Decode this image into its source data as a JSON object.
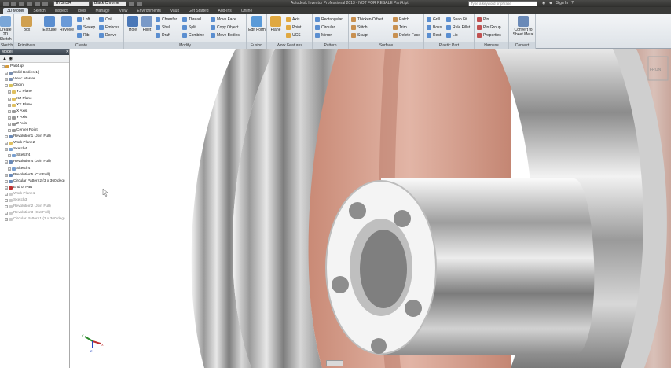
{
  "titlebar": {
    "combo1": "BVS.ISR",
    "combo2": "Black Chrome",
    "title": "Autodesk Inventor Professional 2013 - NOT FOR RESALE   Part4.ipt",
    "search_placeholder": "Type a keyword or phrase",
    "user": "Sign In"
  },
  "tabs": [
    "3D Model",
    "Sketch",
    "Inspect",
    "Tools",
    "Manage",
    "View",
    "Environments",
    "Vault",
    "Get Started",
    "Add-Ins",
    "Online"
  ],
  "ribbon": {
    "sketch": {
      "label": "Create 2D Sketch",
      "panel": "Sketch"
    },
    "primitives": {
      "box": "Box",
      "panel": "Primitives"
    },
    "create": {
      "extrude": "Extrude",
      "revolve": "Revolve",
      "loft": "Loft",
      "sweep": "Sweep",
      "rib": "Rib",
      "coil": "Coil",
      "emboss": "Emboss",
      "derive": "Derive",
      "panel": "Create"
    },
    "modify": {
      "hole": "Hole",
      "fillet": "Fillet",
      "chamfer": "Chamfer",
      "shell": "Shell",
      "draft": "Draft",
      "thread": "Thread",
      "split": "Split",
      "combine": "Combine",
      "move_face": "Move Face",
      "copy_object": "Copy Object",
      "move_bodies": "Move Bodies",
      "panel": "Modify"
    },
    "fusion": {
      "edit_form": "Edit Form",
      "panel": "Fusion"
    },
    "work": {
      "plane": "Plane",
      "axis": "Axis",
      "point": "Point",
      "ucs": "UCS",
      "panel": "Work Features"
    },
    "pattern": {
      "rectangular": "Rectangular",
      "circular": "Circular",
      "mirror": "Mirror",
      "panel": "Pattern"
    },
    "surface": {
      "thicken": "Thicken/Offset",
      "stitch": "Stitch",
      "sculpt": "Sculpt",
      "patch": "Patch",
      "trim": "Trim",
      "delete_face": "Delete Face",
      "panel": "Surface"
    },
    "plastic": {
      "grill": "Grill",
      "boss": "Boss",
      "rest": "Rest",
      "snap_fit": "Snap Fit",
      "rule_fillet": "Rule Fillet",
      "lip": "Lip",
      "panel": "Plastic Part"
    },
    "harness": {
      "pin": "Pin",
      "pin_group": "Pin Group",
      "properties": "Properties",
      "panel": "Harness"
    },
    "convert": {
      "label": "Convert to Sheet Metal",
      "panel": "Convert"
    }
  },
  "browser": {
    "title": "Model",
    "nodes": [
      {
        "label": "Part4.ipt",
        "indent": 0,
        "dim": false,
        "color": "#d49a3a"
      },
      {
        "label": "Solid Bodies(1)",
        "indent": 1,
        "dim": false,
        "color": "#7a8fb0"
      },
      {
        "label": "View: Master",
        "indent": 1,
        "dim": false,
        "color": "#7a8fb0"
      },
      {
        "label": "Origin",
        "indent": 1,
        "dim": false,
        "color": "#d8c25a"
      },
      {
        "label": "YZ Plane",
        "indent": 2,
        "dim": false,
        "color": "#e0c060"
      },
      {
        "label": "XZ Plane",
        "indent": 2,
        "dim": false,
        "color": "#e0c060"
      },
      {
        "label": "XY Plane",
        "indent": 2,
        "dim": false,
        "color": "#e0c060"
      },
      {
        "label": "X Axis",
        "indent": 2,
        "dim": false,
        "color": "#999"
      },
      {
        "label": "Y Axis",
        "indent": 2,
        "dim": false,
        "color": "#999"
      },
      {
        "label": "Z Axis",
        "indent": 2,
        "dim": false,
        "color": "#999"
      },
      {
        "label": "Center Point",
        "indent": 2,
        "dim": false,
        "color": "#999"
      },
      {
        "label": "Revolution1 (Join Full)",
        "indent": 1,
        "dim": false,
        "color": "#6a8ab8"
      },
      {
        "label": "Work Plane2",
        "indent": 1,
        "dim": false,
        "color": "#e0c060"
      },
      {
        "label": "Sketch4",
        "indent": 1,
        "dim": false,
        "color": "#7aa0d0"
      },
      {
        "label": "Sketch4",
        "indent": 2,
        "dim": false,
        "color": "#7aa0d0"
      },
      {
        "label": "Revolution4 (Join Full)",
        "indent": 1,
        "dim": false,
        "color": "#6a8ab8"
      },
      {
        "label": "Sketch4",
        "indent": 2,
        "dim": false,
        "color": "#7aa0d0"
      },
      {
        "label": "Revolution5 (Cut Full)",
        "indent": 1,
        "dim": false,
        "color": "#6a8ab8"
      },
      {
        "label": "Circular Pattern2 (3 x 360 deg)",
        "indent": 1,
        "dim": false,
        "color": "#6a8ab8"
      },
      {
        "label": "End of Part",
        "indent": 1,
        "dim": false,
        "color": "#c03030"
      },
      {
        "label": "Work Plane1",
        "indent": 1,
        "dim": true,
        "color": "#ccc"
      },
      {
        "label": "Sketch3",
        "indent": 1,
        "dim": true,
        "color": "#ccc"
      },
      {
        "label": "Revolution2 (Join Full)",
        "indent": 1,
        "dim": true,
        "color": "#ccc"
      },
      {
        "label": "Revolution3 (Cut Full)",
        "indent": 1,
        "dim": true,
        "color": "#ccc"
      },
      {
        "label": "Circular Pattern1 (3 x 360 deg)",
        "indent": 1,
        "dim": true,
        "color": "#ccc"
      }
    ]
  },
  "viewcube": {
    "label": "FRONT"
  },
  "triad": {
    "x": "X",
    "y": "Y",
    "z": "Z"
  },
  "colors": {
    "copper": "#d49c8a",
    "chrome": "#bcbcbc",
    "ribbon": "#e6eaee"
  }
}
